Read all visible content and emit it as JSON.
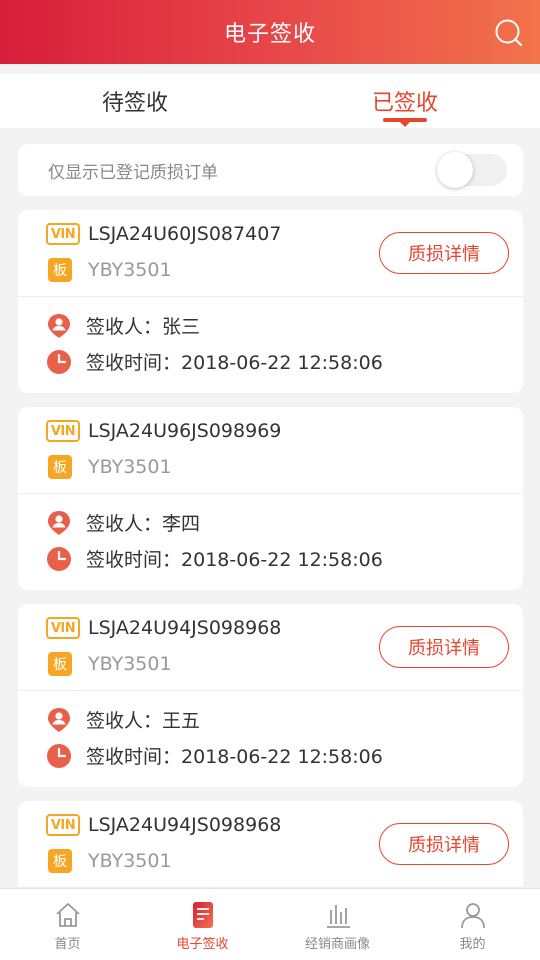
{
  "header": {
    "title": "电子签收"
  },
  "tabs": [
    {
      "label": "待签收",
      "active": false
    },
    {
      "label": "已签收",
      "active": true
    }
  ],
  "filter": {
    "label": "仅显示已登记质损订单",
    "toggle_on": false
  },
  "badges": {
    "vin": "VIN",
    "ban": "板"
  },
  "labels": {
    "receiver": "签收人：",
    "time": "签收时间：",
    "detail_button": "质损详情"
  },
  "cards": [
    {
      "vin": "LSJA24U60JS087407",
      "plate": "YBY3501",
      "receiver": "张三",
      "time": "2018-06-22 12:58:06",
      "has_detail": true
    },
    {
      "vin": "LSJA24U96JS098969",
      "plate": "YBY3501",
      "receiver": "李四",
      "time": "2018-06-22 12:58:06",
      "has_detail": false
    },
    {
      "vin": "LSJA24U94JS098968",
      "plate": "YBY3501",
      "receiver": "王五",
      "time": "2018-06-22 12:58:06",
      "has_detail": true
    },
    {
      "vin": "LSJA24U94JS098968",
      "plate": "YBY3501",
      "receiver": "",
      "time": "",
      "has_detail": true
    }
  ],
  "tabbar": [
    {
      "label": "首页",
      "icon": "home-icon",
      "active": false
    },
    {
      "label": "电子签收",
      "icon": "document-icon",
      "active": true
    },
    {
      "label": "经销商画像",
      "icon": "bar-chart-icon",
      "active": false
    },
    {
      "label": "我的",
      "icon": "user-icon",
      "active": false
    }
  ],
  "colors": {
    "accent": "#e8452f",
    "badge": "#f5a623",
    "header_start": "#d81e3a",
    "header_end": "#f2734a"
  }
}
